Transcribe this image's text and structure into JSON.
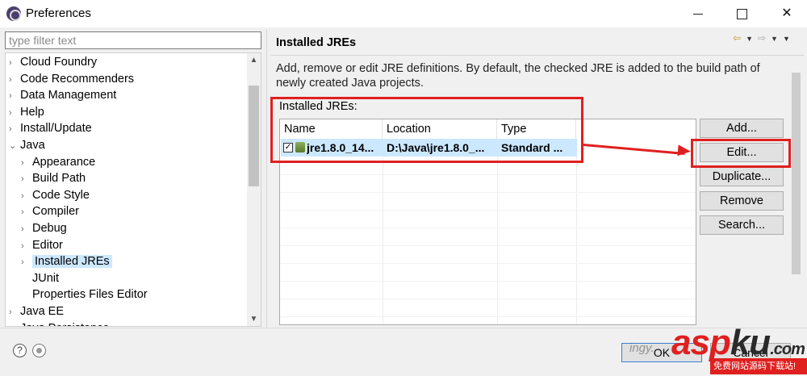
{
  "window": {
    "title": "Preferences"
  },
  "filter": {
    "placeholder": "type filter text"
  },
  "tree": {
    "items": [
      {
        "label": "Cloud Foundry",
        "arrow": "›",
        "level": 0,
        "selected": false
      },
      {
        "label": "Code Recommenders",
        "arrow": "›",
        "level": 0,
        "selected": false
      },
      {
        "label": "Data Management",
        "arrow": "›",
        "level": 0,
        "selected": false
      },
      {
        "label": "Help",
        "arrow": "›",
        "level": 0,
        "selected": false
      },
      {
        "label": "Install/Update",
        "arrow": "›",
        "level": 0,
        "selected": false
      },
      {
        "label": "Java",
        "arrow": "⌄",
        "level": 0,
        "selected": false
      },
      {
        "label": "Appearance",
        "arrow": "›",
        "level": 1,
        "selected": false
      },
      {
        "label": "Build Path",
        "arrow": "›",
        "level": 1,
        "selected": false
      },
      {
        "label": "Code Style",
        "arrow": "›",
        "level": 1,
        "selected": false
      },
      {
        "label": "Compiler",
        "arrow": "›",
        "level": 1,
        "selected": false
      },
      {
        "label": "Debug",
        "arrow": "›",
        "level": 1,
        "selected": false
      },
      {
        "label": "Editor",
        "arrow": "›",
        "level": 1,
        "selected": false
      },
      {
        "label": "Installed JREs",
        "arrow": "›",
        "level": 1,
        "selected": true
      },
      {
        "label": "JUnit",
        "arrow": "",
        "level": 1,
        "selected": false
      },
      {
        "label": "Properties Files Editor",
        "arrow": "",
        "level": 1,
        "selected": false
      },
      {
        "label": "Java EE",
        "arrow": "›",
        "level": 0,
        "selected": false
      },
      {
        "label": "Java Persistence",
        "arrow": "›",
        "level": 0,
        "selected": false
      }
    ]
  },
  "page": {
    "title": "Installed JREs",
    "description": "Add, remove or edit JRE definitions. By default, the checked JRE is added to the build path of newly created Java projects.",
    "list_label": "Installed JREs:"
  },
  "table": {
    "columns": [
      "Name",
      "Location",
      "Type"
    ],
    "rows": [
      {
        "checked": true,
        "name": "jre1.8.0_14...",
        "location": "D:\\Java\\jre1.8.0_...",
        "type": "Standard ..."
      }
    ]
  },
  "buttons": {
    "add": "Add...",
    "edit": "Edit...",
    "duplicate": "Duplicate...",
    "remove": "Remove",
    "search": "Search..."
  },
  "footer": {
    "help_icon": "?",
    "ok": "OK",
    "cancel": "Cancel"
  },
  "watermark": {
    "text": "ingy.",
    "logo_main": "asp",
    "logo_ku": "ku",
    "logo_suffix": ".com",
    "tagline": "免费网站源码下载站!"
  },
  "colors": {
    "selection": "#cce8ff",
    "annotation_red": "#e02020",
    "button_face": "#e1e1e1"
  }
}
